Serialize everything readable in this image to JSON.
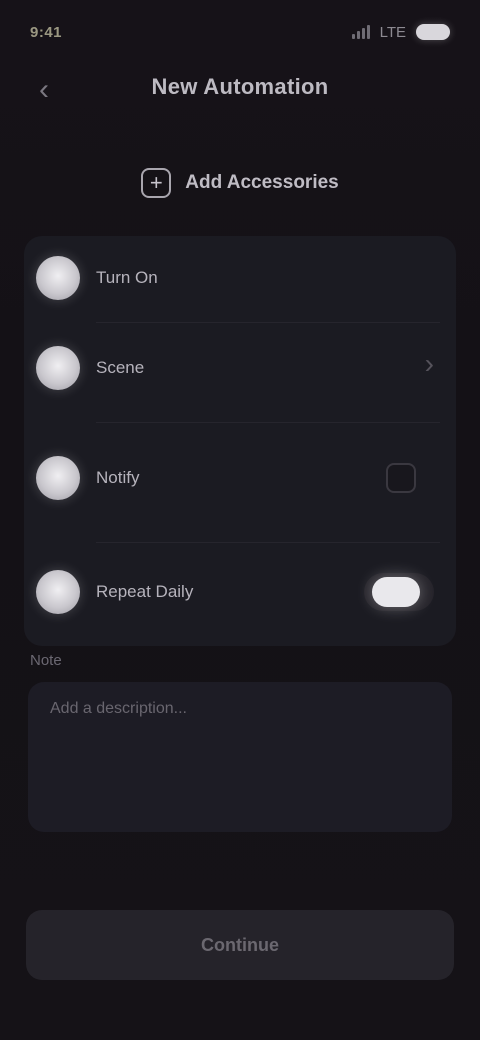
{
  "status_bar": {
    "time": "9:41",
    "network": "LTE"
  },
  "header": {
    "back_glyph": "‹",
    "title": "New Automation"
  },
  "add_device": {
    "label": "Add Accessories",
    "icon": "plus-square-icon"
  },
  "options": [
    {
      "label": "Turn On",
      "control": "none"
    },
    {
      "label": "Scene",
      "control": "chevron"
    },
    {
      "label": "Notify",
      "control": "checkbox"
    },
    {
      "label": "Repeat Daily",
      "control": "toggle",
      "toggle_on": true
    }
  ],
  "note": {
    "section_label": "Note",
    "placeholder": "Add a description..."
  },
  "primary_button": {
    "label": "Continue"
  }
}
